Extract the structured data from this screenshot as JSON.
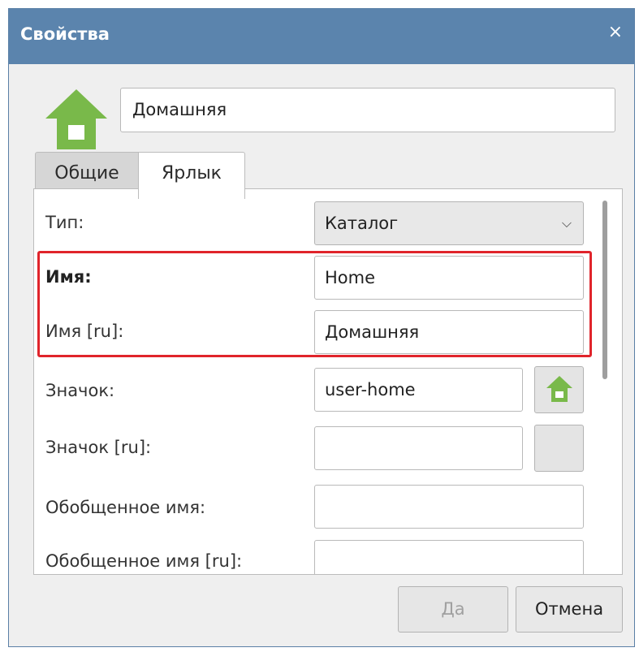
{
  "window": {
    "title": "Свойства",
    "close_glyph": "×"
  },
  "header": {
    "icon": "home-folder-icon",
    "name_value": "Домашняя"
  },
  "tabs": [
    {
      "label": "Общие",
      "active": false
    },
    {
      "label": "Ярлык",
      "active": true
    }
  ],
  "form": {
    "type": {
      "label": "Тип:",
      "value": "Каталог",
      "chevron": "⌵"
    },
    "name": {
      "label": "Имя:",
      "value": "Home"
    },
    "name_ru": {
      "label": "Имя [ru]:",
      "value": "Домашняя"
    },
    "icon": {
      "label": "Значок:",
      "value": "user-home",
      "preview": "home-folder-icon"
    },
    "icon_ru": {
      "label": "Значок [ru]:",
      "value": ""
    },
    "generic_name": {
      "label": "Обобщенное имя:",
      "value": ""
    },
    "generic_name_ru": {
      "label": "Обобщенное имя [ru]:",
      "value": ""
    }
  },
  "buttons": {
    "ok": "Да",
    "ok_enabled": false,
    "cancel": "Отмена"
  },
  "colors": {
    "titlebar": "#5b84ad",
    "highlight": "#e0242b",
    "icon_green": "#79b94a"
  }
}
